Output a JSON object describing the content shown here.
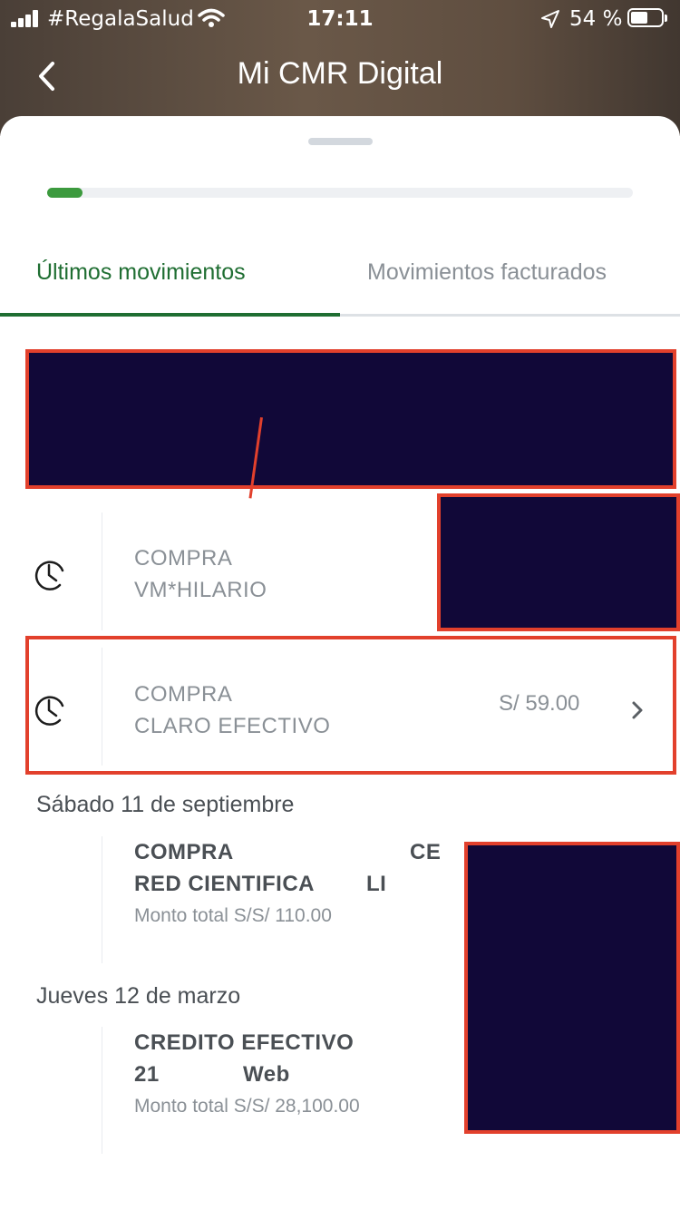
{
  "status_bar": {
    "carrier": "#RegalaSalud",
    "time": "17:11",
    "battery_percent": "54 %"
  },
  "header": {
    "title": "Mi CMR Digital"
  },
  "progress": {
    "value_fraction": 0.06,
    "color": "#3c9a3e"
  },
  "tabs": [
    {
      "label": "Últimos movimientos",
      "active": true
    },
    {
      "label": "Movimientos facturados",
      "active": false
    }
  ],
  "pending_movements": [
    {
      "type": "COMPRA",
      "merchant": "VM*HILARIO",
      "amount": ""
    },
    {
      "type": "COMPRA",
      "merchant": "CLARO EFECTIVO",
      "amount": "S/ 59.00"
    }
  ],
  "date_groups": [
    {
      "date": "Sábado 11 de septiembre",
      "line1": "COMPRA",
      "line1_tail": "CE",
      "line2": "RED CIENTIFICA",
      "line2_tail": "LI",
      "total": "Monto total S/S/ 110.00"
    },
    {
      "date": "Jueves 12 de marzo",
      "line1": "CREDITO EFECTIVO",
      "line2": "21",
      "line2_tail": "Web",
      "total": "Monto total S/S/ 28,100.00"
    }
  ],
  "colors": {
    "accent_green": "#1f6e32",
    "redaction_fill": "#110838",
    "redaction_border": "#e2402c"
  },
  "icons": [
    "back-arrow-icon",
    "clock-icon",
    "chevron-right-icon",
    "wifi-icon",
    "location-arrow-icon",
    "battery-icon",
    "signal-bars-icon"
  ]
}
